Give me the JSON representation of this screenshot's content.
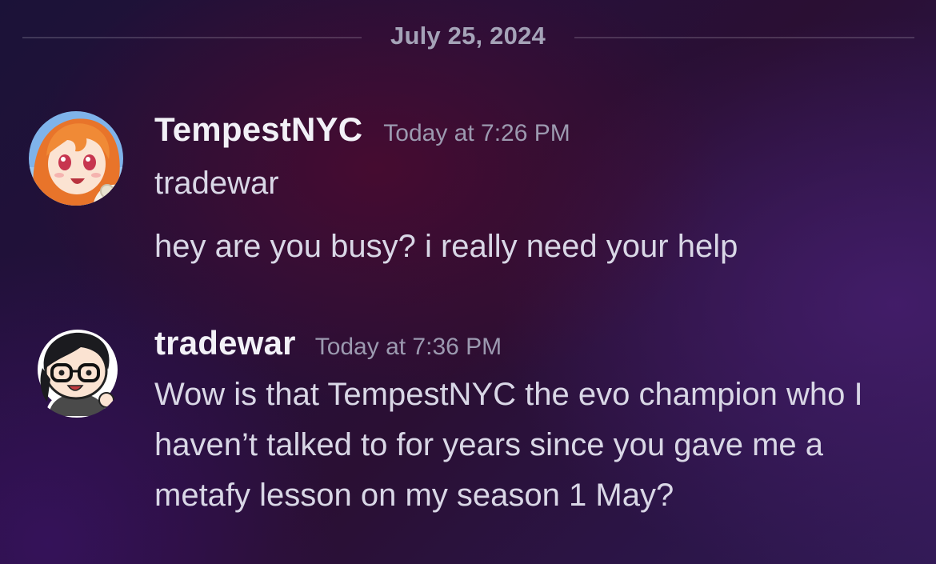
{
  "date_separator": "July 25, 2024",
  "messages": [
    {
      "username": "TempestNYC",
      "timestamp": "Today at 7:26 PM",
      "lines": [
        "tradewar",
        "hey are you busy? i really need your help"
      ],
      "avatar_icon": "anime-orange-hair-avatar"
    },
    {
      "username": "tradewar",
      "timestamp": "Today at 7:36 PM",
      "lines": [
        "Wow is that TempestNYC the evo champion who I haven’t talked to for years since you gave me a metafy lesson on my season 1 May?"
      ],
      "avatar_icon": "chibi-glasses-avatar"
    }
  ],
  "colors": {
    "username": "#f2f1f7",
    "timestamp": "#9c9ab0",
    "message_text": "#d9d7e6",
    "divider": "#4a4560"
  }
}
